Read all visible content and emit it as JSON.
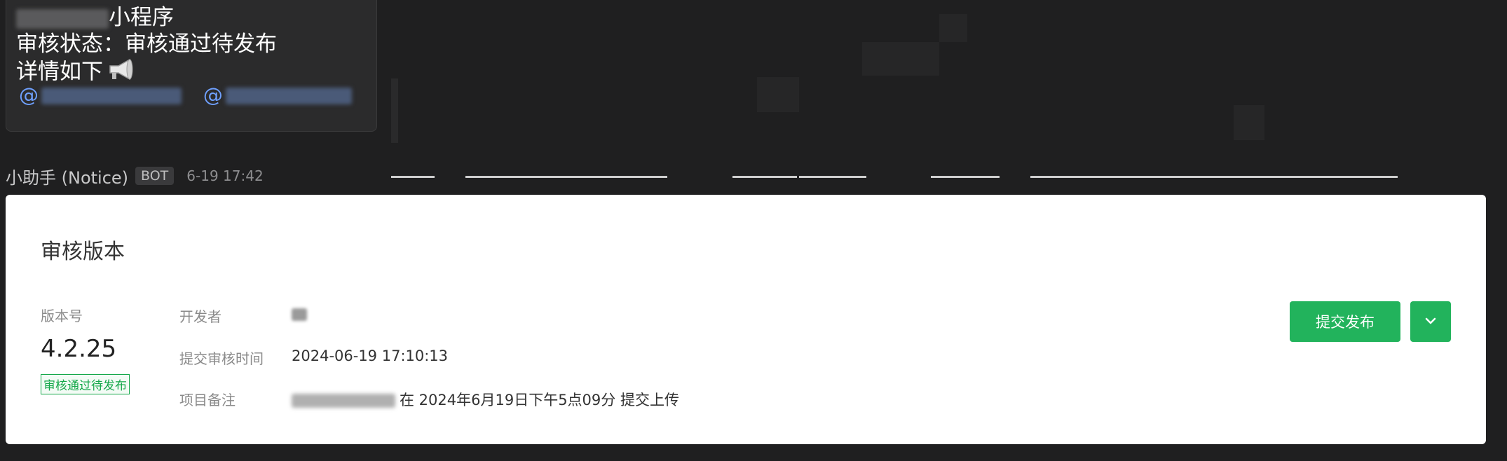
{
  "previous_message": {
    "line1_suffix": "小程序",
    "line2": "审核状态：审核通过待发布",
    "line3": "详情如下",
    "mention_prefix_1": "@",
    "mention_prefix_2": "@"
  },
  "sender": {
    "name": "小助手 (Notice)",
    "badge": "BOT",
    "time": "6-19 17:42"
  },
  "card": {
    "title": "审核版本",
    "version_label": "版本号",
    "version_number": "4.2.25",
    "version_status": "审核通过待发布",
    "developer_label": "开发者",
    "submit_time_label": "提交审核时间",
    "submit_time_value": "2024-06-19 17:10:13",
    "remark_label": "项目备注",
    "remark_value": "在 2024年6月19日下午5点09分 提交上传",
    "publish_button": "提交发布"
  },
  "colors": {
    "accent": "#22b35c",
    "background": "#1f1f20",
    "mention": "#6fa0ff"
  }
}
